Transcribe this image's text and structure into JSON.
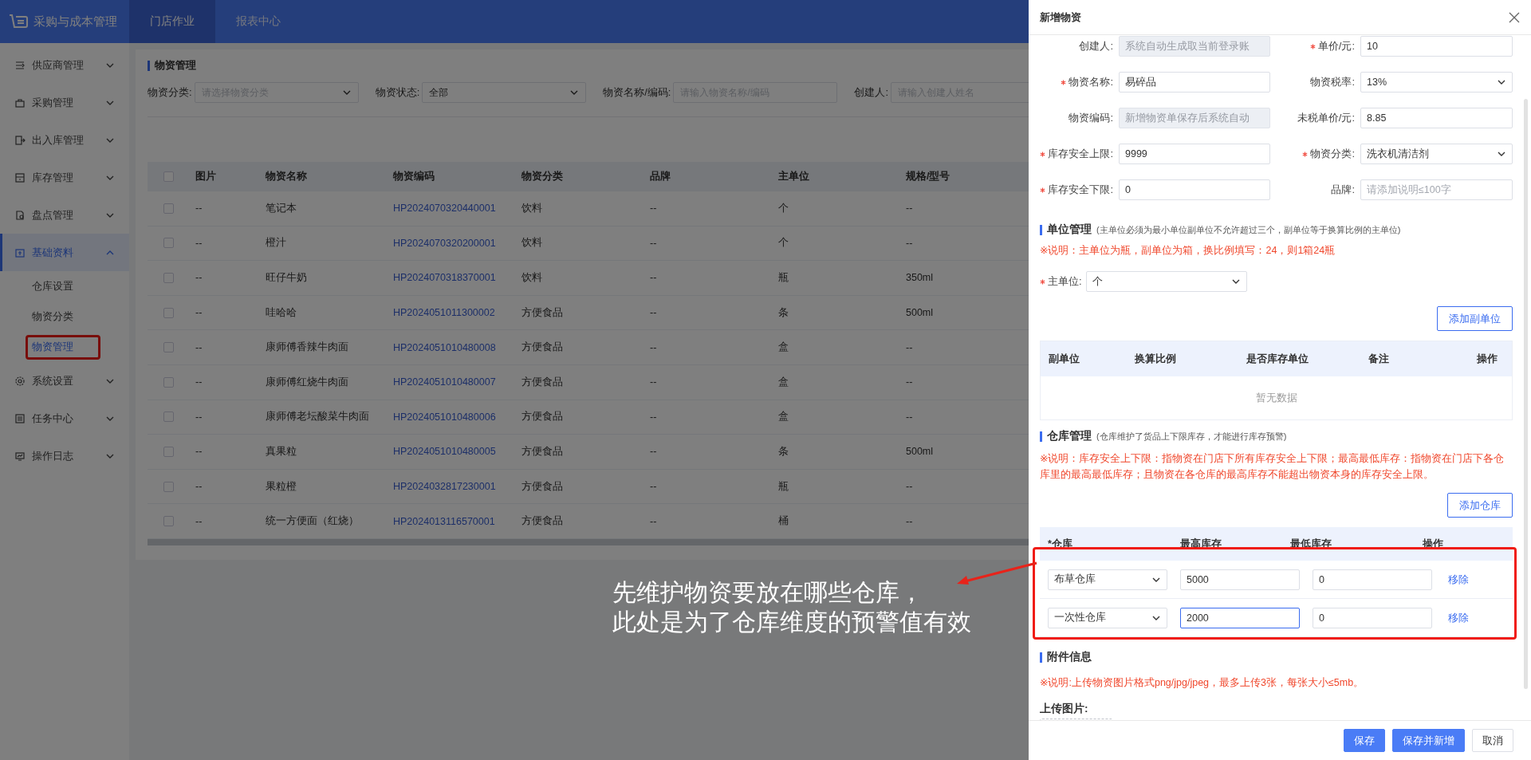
{
  "app": {
    "title": "采购与成本管理",
    "nav": [
      {
        "label": "门店作业",
        "selected": true
      },
      {
        "label": "报表中心",
        "selected": false
      }
    ]
  },
  "sidebar": {
    "items": [
      {
        "label": "供应商管理",
        "selected": false,
        "expanded": false
      },
      {
        "label": "采购管理",
        "selected": false,
        "expanded": false
      },
      {
        "label": "出入库管理",
        "selected": false,
        "expanded": false
      },
      {
        "label": "库存管理",
        "selected": false,
        "expanded": false
      },
      {
        "label": "盘点管理",
        "selected": false,
        "expanded": false
      },
      {
        "label": "基础资料",
        "selected": true,
        "expanded": true,
        "children": [
          {
            "label": "仓库设置",
            "selected": false,
            "boxed": false
          },
          {
            "label": "物资分类",
            "selected": false,
            "boxed": false
          },
          {
            "label": "物资管理",
            "selected": true,
            "boxed": true
          }
        ]
      },
      {
        "label": "系统设置",
        "selected": false,
        "expanded": false
      },
      {
        "label": "任务中心",
        "selected": false,
        "expanded": false
      },
      {
        "label": "操作日志",
        "selected": false,
        "expanded": false
      }
    ]
  },
  "page": {
    "title": "物资管理",
    "filters": [
      {
        "label": "物资分类:",
        "kind": "select",
        "placeholder": "请选择物资分类"
      },
      {
        "label": "物资状态:",
        "kind": "select",
        "value": "全部"
      },
      {
        "label": "物资名称/编码:",
        "kind": "input",
        "placeholder": "请输入物资名称/编码"
      },
      {
        "label": "创建人:",
        "kind": "input",
        "placeholder": "请输入创建人姓名"
      }
    ],
    "table": {
      "all_checked": false,
      "columns": [
        "图片",
        "物资名称",
        "物资编码",
        "物资分类",
        "品牌",
        "主单位",
        "规格/型号"
      ],
      "rows": [
        {
          "checked": false,
          "image": "--",
          "name": "笔记本",
          "code": "HP2024070320440001",
          "category": "饮料",
          "brand": "--",
          "unit": "个",
          "spec": "--"
        },
        {
          "checked": false,
          "image": "--",
          "name": "橙汁",
          "code": "HP2024070320200001",
          "category": "饮料",
          "brand": "--",
          "unit": "个",
          "spec": "--"
        },
        {
          "checked": false,
          "image": "--",
          "name": "旺仔牛奶",
          "code": "HP2024070318370001",
          "category": "饮料",
          "brand": "--",
          "unit": "瓶",
          "spec": "350ml"
        },
        {
          "checked": false,
          "image": "--",
          "name": "哇哈哈",
          "code": "HP2024051011300002",
          "category": "方便食品",
          "brand": "--",
          "unit": "条",
          "spec": "500ml"
        },
        {
          "checked": false,
          "image": "--",
          "name": "康师傅香辣牛肉面",
          "code": "HP2024051010480008",
          "category": "方便食品",
          "brand": "--",
          "unit": "盒",
          "spec": "--"
        },
        {
          "checked": false,
          "image": "--",
          "name": "康师傅红烧牛肉面",
          "code": "HP2024051010480007",
          "category": "方便食品",
          "brand": "--",
          "unit": "盒",
          "spec": "--"
        },
        {
          "checked": false,
          "image": "--",
          "name": "康师傅老坛酸菜牛肉面",
          "code": "HP2024051010480006",
          "category": "方便食品",
          "brand": "--",
          "unit": "盒",
          "spec": "--"
        },
        {
          "checked": false,
          "image": "--",
          "name": "真果粒",
          "code": "HP2024051010480005",
          "category": "方便食品",
          "brand": "--",
          "unit": "条",
          "spec": "500ml"
        },
        {
          "checked": false,
          "image": "--",
          "name": "果粒橙",
          "code": "HP2024032817230001",
          "category": "方便食品",
          "brand": "--",
          "unit": "瓶",
          "spec": "--"
        },
        {
          "checked": false,
          "image": "--",
          "name": "统一方便面（红烧）",
          "code": "HP2024013116570001",
          "category": "方便食品",
          "brand": "--",
          "unit": "桶",
          "spec": "--"
        }
      ]
    }
  },
  "drawer": {
    "title": "新增物资",
    "fields": [
      {
        "label": "创建人:",
        "required": false,
        "kind": "input",
        "placeholder": "系统自动生成取当前登录账",
        "disabled": true
      },
      {
        "label": "单价/元:",
        "required": true,
        "kind": "input",
        "value": "10",
        "disabled": false
      },
      {
        "label": "物资名称:",
        "required": true,
        "kind": "input",
        "value": "易碎品",
        "disabled": false
      },
      {
        "label": "物资税率:",
        "required": false,
        "kind": "select",
        "value": "13%",
        "disabled": false
      },
      {
        "label": "物资编码:",
        "required": false,
        "kind": "input",
        "placeholder": "新增物资单保存后系统自动",
        "disabled": true
      },
      {
        "label": "未税单价/元:",
        "required": false,
        "kind": "input",
        "value": "8.85",
        "disabled": false
      },
      {
        "label": "库存安全上限:",
        "required": true,
        "kind": "input",
        "value": "9999",
        "disabled": false
      },
      {
        "label": "物资分类:",
        "required": true,
        "kind": "select",
        "value": "洗衣机清洁剂",
        "disabled": false
      },
      {
        "label": "库存安全下限:",
        "required": true,
        "kind": "input",
        "value": "0",
        "disabled": false
      },
      {
        "label": "品牌:",
        "required": false,
        "kind": "input",
        "placeholder": "请添加说明≤100字",
        "disabled": false
      }
    ],
    "unit_section": {
      "title": "单位管理",
      "hint": "(主单位必须为最小单位副单位不允许超过三个，副单位等于换算比例的主单位)",
      "note": "※说明：主单位为瓶，副单位为箱，换比例填写：24，则1箱24瓶",
      "main_unit": {
        "label": "主单位:",
        "required": true,
        "value": "个"
      },
      "add_button": "添加副单位",
      "table": {
        "columns": [
          "副单位",
          "换算比例",
          "是否库存单位",
          "备注",
          "操作"
        ],
        "empty_text": "暂无数据"
      }
    },
    "warehouse_section": {
      "title": "仓库管理",
      "hint": "(仓库维护了货品上下限库存，才能进行库存预警)",
      "note": "※说明：库存安全上下限：指物资在门店下所有库存安全上下限；最高最低库存：指物资在门店下各仓库里的最高最低库存；且物资在各仓库的最高库存不能超出物资本身的库存安全上限。",
      "add_button": "添加仓库",
      "boxed": true,
      "table": {
        "columns": [
          "*仓库",
          "最高库存",
          "最低库存",
          "操作"
        ],
        "rows": [
          {
            "warehouse": "布草仓库",
            "max": "5000",
            "min": "0",
            "action": "移除",
            "focused": false
          },
          {
            "warehouse": "一次性仓库",
            "max": "2000",
            "min": "0",
            "action": "移除",
            "focused": true
          }
        ]
      }
    },
    "attachment_section": {
      "title": "附件信息",
      "note": "※说明:上传物资图片格式png/jpg/jpeg，最多上传3张，每张大小≤5mb。",
      "upload_label": "上传图片:"
    },
    "buttons": [
      {
        "label": "保存",
        "kind": "primary"
      },
      {
        "label": "保存并新增",
        "kind": "primary"
      },
      {
        "label": "取消",
        "kind": "default"
      }
    ]
  },
  "annotation": {
    "lines": [
      "先维护物资要放在哪些仓库，",
      "此处是为了仓库维度的预警值有效"
    ]
  }
}
